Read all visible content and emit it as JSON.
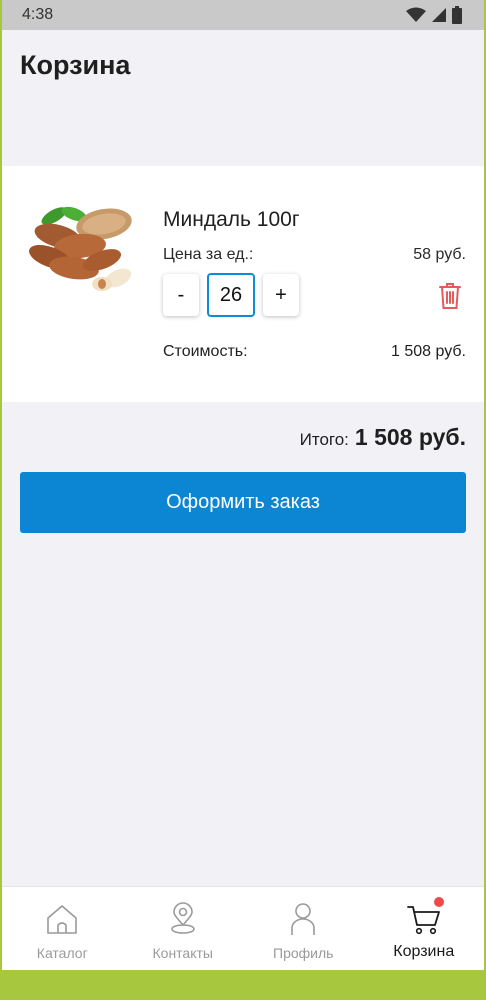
{
  "status_bar": {
    "time": "4:38"
  },
  "page": {
    "title": "Корзина"
  },
  "cart_item": {
    "name": "Миндаль 100г",
    "unit_price_label": "Цена за ед.:",
    "unit_price_value": "58 руб.",
    "quantity": "26",
    "minus_label": "-",
    "plus_label": "+",
    "cost_label": "Стоимость:",
    "cost_value": "1 508 руб."
  },
  "summary": {
    "total_label": "Итого:",
    "total_value": "1 508 руб."
  },
  "checkout": {
    "button_label": "Оформить заказ",
    "color": "#0c86d2"
  },
  "bottom_nav": {
    "items": [
      {
        "label": "Каталог",
        "icon": "home-icon"
      },
      {
        "label": "Контакты",
        "icon": "location-pin-icon"
      },
      {
        "label": "Профиль",
        "icon": "person-icon"
      },
      {
        "label": "Корзина",
        "icon": "cart-icon",
        "active": true
      }
    ]
  },
  "colors": {
    "accent": "#0c86d2",
    "delete": "#e55b5b",
    "badge": "#ef4a4a"
  }
}
